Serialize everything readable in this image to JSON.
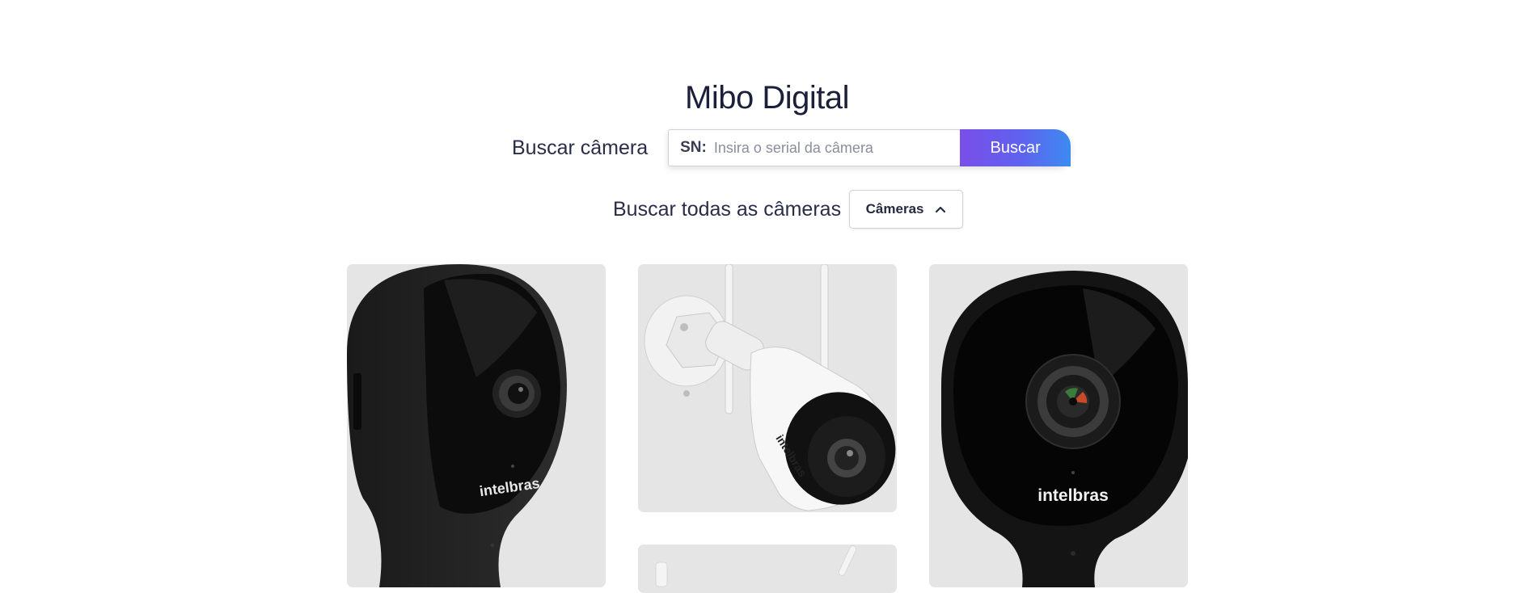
{
  "header": {
    "title": "Mibo Digital"
  },
  "search": {
    "label": "Buscar câmera",
    "prefix": "SN:",
    "placeholder": "Insira o serial da câmera",
    "button_label": "Buscar"
  },
  "filter": {
    "label": "Buscar todas as câmeras",
    "selected": "Câmeras",
    "icon": "chevron-up-icon"
  },
  "products": [
    {
      "brand": "intelbras",
      "icon": "indoor-camera-image"
    },
    {
      "brand": "intelbras",
      "icon": "outdoor-bullet-camera-image"
    },
    {
      "brand": "intelbras",
      "icon": "indoor-camera-front-image"
    },
    {
      "brand": "",
      "icon": "camera-image"
    }
  ],
  "colors": {
    "accent_start": "#7a4ee8",
    "accent_end": "#3d8bf0",
    "card_bg": "#e5e5e5"
  }
}
